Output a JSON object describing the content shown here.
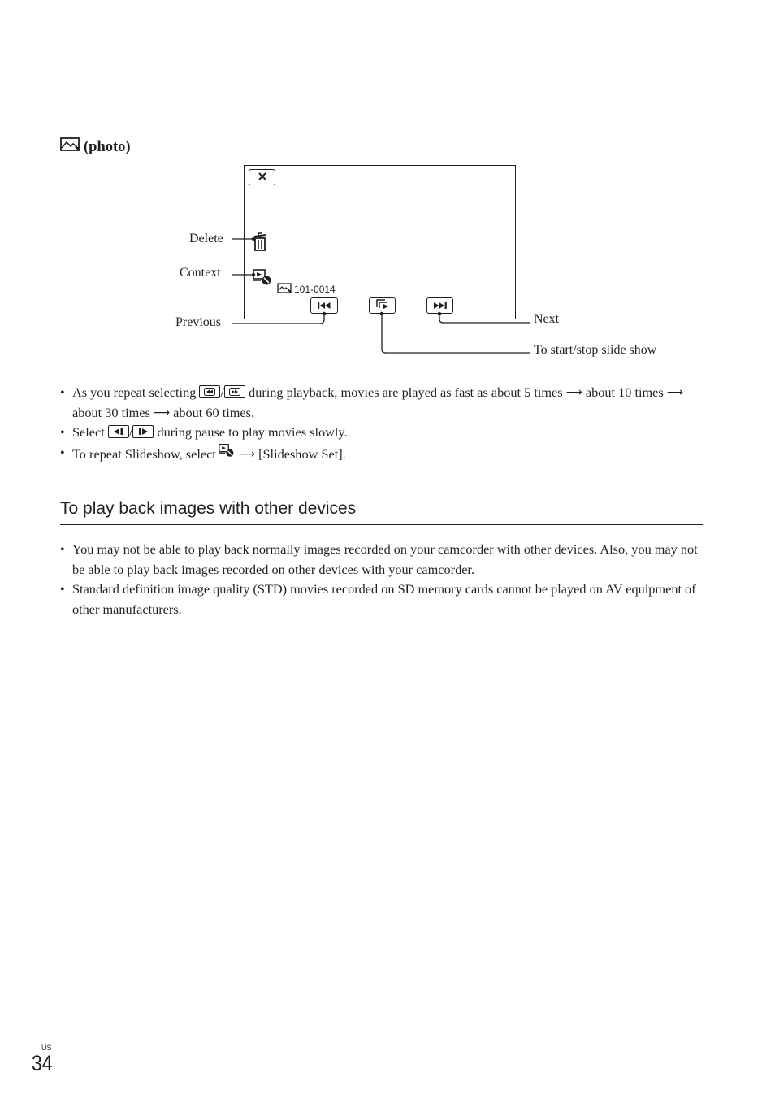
{
  "photo_section": {
    "icon": "photo-icon",
    "title": "(photo)"
  },
  "diagram": {
    "file_number": "101-0014",
    "buttons": {
      "close": "close-icon",
      "delete": "trash-icon",
      "context": "context-icon",
      "previous": "skip-previous-icon",
      "slideshow": "slideshow-icon",
      "next": "skip-next-icon"
    },
    "callouts": {
      "delete": "Delete",
      "context": "Context",
      "previous": "Previous",
      "next": "Next",
      "slideshow": "To start/stop slide show"
    }
  },
  "notes": [
    {
      "parts": [
        "As you repeat selecting",
        "/",
        "during playback, movies are played as fast as about 5 times",
        "about 10 times",
        "about 30 times",
        "about 60 times."
      ],
      "icons": [
        "rewind-icon",
        "fast-forward-icon"
      ]
    },
    {
      "parts": [
        "Select",
        "/",
        "during pause to play movies slowly."
      ],
      "icons": [
        "slow-reverse-icon",
        "slow-forward-icon"
      ]
    },
    {
      "parts": [
        "To repeat Slideshow, select",
        "[Slideshow Set]."
      ],
      "icons": [
        "context-icon"
      ]
    }
  ],
  "section": {
    "title": "To play back images with other devices",
    "bullets": [
      "You may not be able to play back normally images recorded on your camcorder with other devices. Also, you may not be able to  play back images recorded on other devices with your camcorder.",
      "Standard definition image quality (STD) movies recorded on SD memory cards cannot be played on AV equipment of other manufacturers."
    ]
  },
  "footer": {
    "region": "US",
    "page_number": "34"
  }
}
